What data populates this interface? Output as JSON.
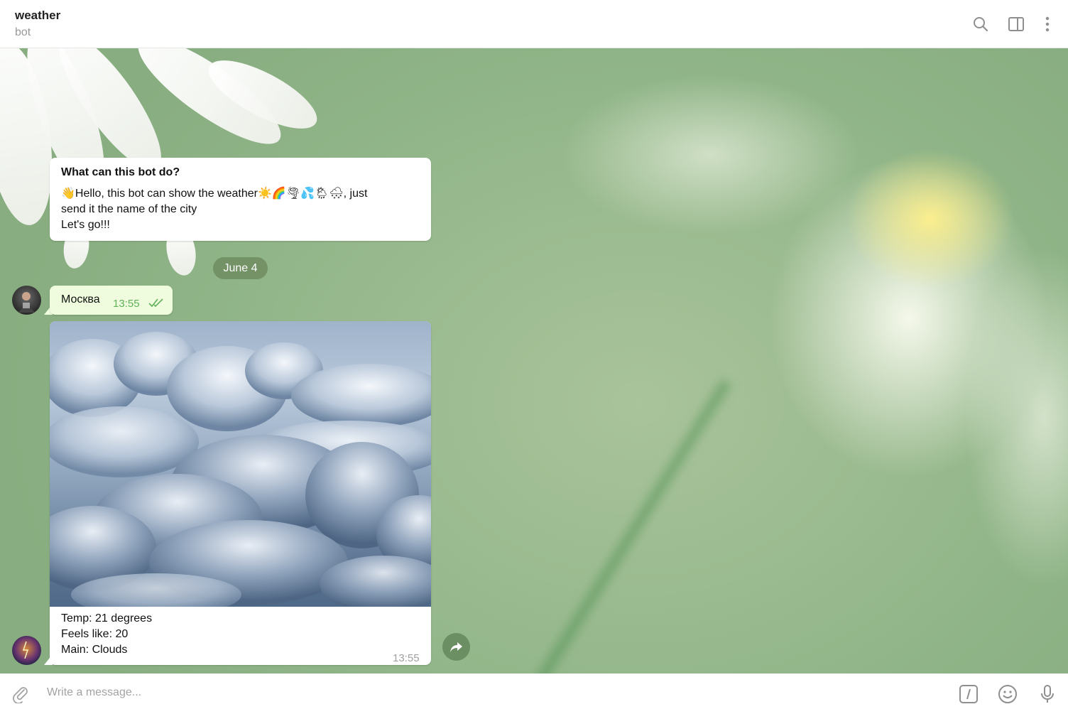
{
  "header": {
    "title": "weather",
    "subtitle": "bot",
    "icons": [
      "search-icon",
      "sidebar-toggle-icon",
      "more-vertical-icon"
    ]
  },
  "chat": {
    "info": {
      "title": "What can this bot do?",
      "line1": "👋Hello, this bot can show the weather☀️🌈🌪💦🌦🌨, just",
      "line2": "send it the name of the city",
      "line3": "Let's go!!!"
    },
    "date": "June 4",
    "outgoing": {
      "text": "Москва",
      "time": "13:55",
      "status": "read"
    },
    "incoming": {
      "photo": "clouds",
      "line1": "Temp: 21 degrees",
      "line2": "Feels like: 20",
      "line3": "Main: Clouds",
      "time": "13:55"
    }
  },
  "composer": {
    "placeholder": "Write a message...",
    "icons": [
      "attach-icon",
      "bot-command-icon",
      "emoji-icon",
      "microphone-icon"
    ]
  },
  "colors": {
    "outgoing_bubble": "#effdde",
    "accent_green": "#5fb15a"
  }
}
